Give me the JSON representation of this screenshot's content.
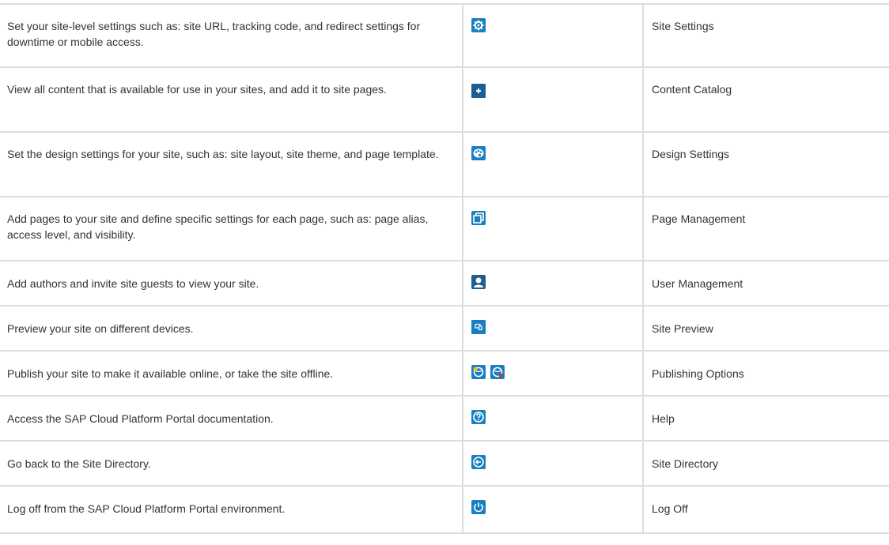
{
  "colors": {
    "icon_blue": "#1a7fc1",
    "icon_dark": "#1d5f93",
    "border": "#dddddd",
    "text": "#333333"
  },
  "rows": [
    {
      "description": "Set your site-level settings such as: site URL, tracking code, and redirect settings for downtime or mobile access.",
      "icons": [
        "gear-icon"
      ],
      "tool": "Site Settings"
    },
    {
      "description": "View all content that is available for use in your sites, and add it to site pages.",
      "icons": [
        "plus-icon"
      ],
      "tool": "Content Catalog"
    },
    {
      "description": "Set the design settings for your site, such as: site layout, site theme, and page template.",
      "icons": [
        "palette-icon"
      ],
      "tool": "Design Settings"
    },
    {
      "description": "Add pages to your site and define specific settings for each page, such as: page alias, access level, and visibility.",
      "icons": [
        "pages-icon"
      ],
      "tool": "Page Management"
    },
    {
      "description": "Add authors and invite site guests to view your site.",
      "icons": [
        "user-icon"
      ],
      "tool": "User Management"
    },
    {
      "description": "Preview your site on different devices.",
      "icons": [
        "devices-icon"
      ],
      "tool": "Site Preview"
    },
    {
      "description": "Publish your site to make it available online, or take the site offline.",
      "icons": [
        "globe-publish-icon",
        "globe-offline-icon"
      ],
      "tool": "Publishing Options"
    },
    {
      "description": "Access the SAP Cloud Platform Portal documentation.",
      "icons": [
        "help-icon"
      ],
      "tool": "Help"
    },
    {
      "description": "Go back to the Site Directory.",
      "icons": [
        "back-icon"
      ],
      "tool": "Site Directory"
    },
    {
      "description": "Log off from the SAP Cloud Platform Portal environment.",
      "icons": [
        "log-off-icon"
      ],
      "tool": "Log Off"
    }
  ]
}
